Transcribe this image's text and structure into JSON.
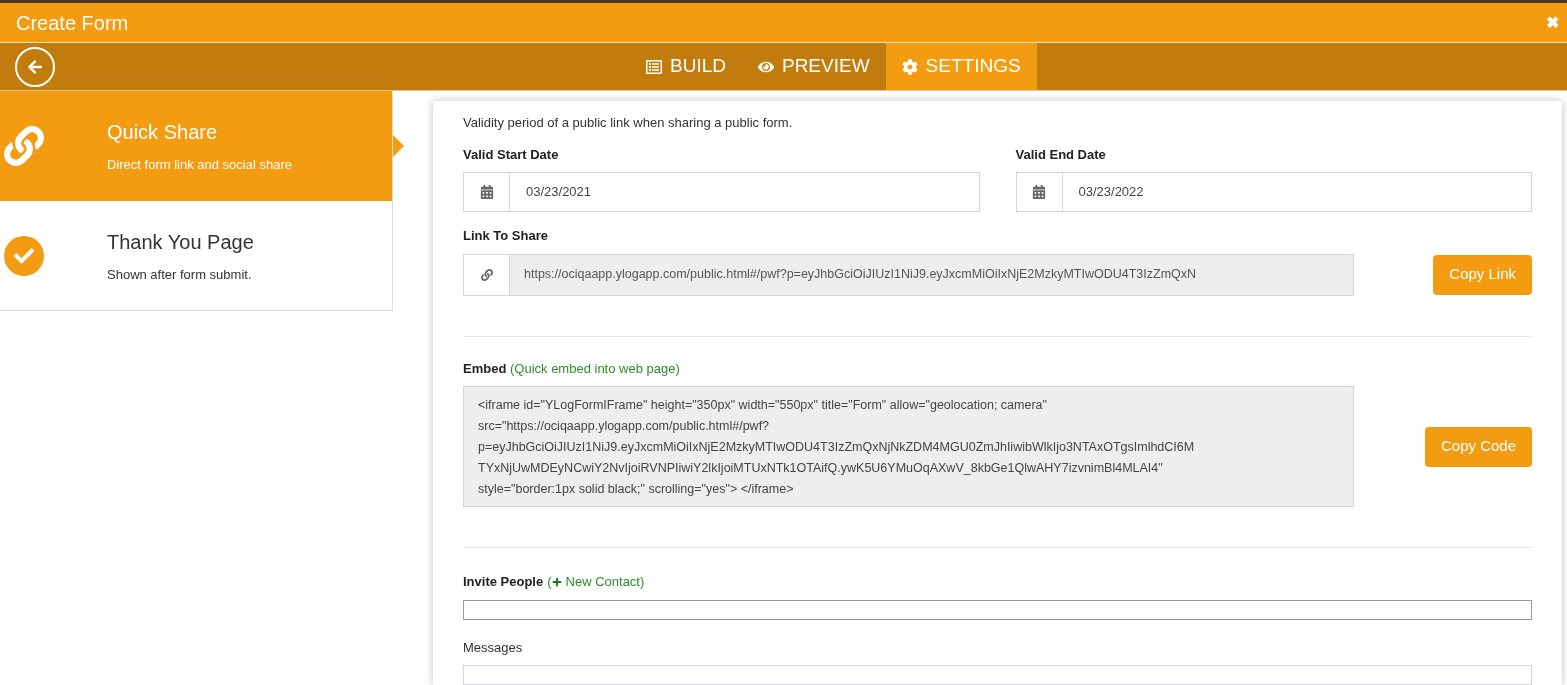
{
  "window": {
    "title": "Create Form",
    "close": "✖"
  },
  "nav_tabs": [
    {
      "label": "BUILD",
      "selected": false
    },
    {
      "label": "PREVIEW",
      "selected": false
    },
    {
      "label": "SETTINGS",
      "selected": true
    }
  ],
  "sidebar": {
    "items": [
      {
        "title": "Quick Share",
        "subtitle": "Direct form link and social share",
        "selected": true
      },
      {
        "title": "Thank You Page",
        "subtitle": "Shown after form submit.",
        "selected": false
      }
    ]
  },
  "settings": {
    "intro": "Validity period of a public link when sharing a public form.",
    "start_date": {
      "label": "Valid Start Date",
      "value": "03/23/2021"
    },
    "end_date": {
      "label": "Valid End Date",
      "value": "03/23/2022"
    },
    "link": {
      "label": "Link To Share",
      "value": "https://ociqaapp.ylogapp.com/public.html#/pwf?p=eyJhbGciOiJIUzI1NiJ9.eyJxcmMiOiIxNjE2MzkyMTIwODU4T3IzZmQxN",
      "button": "Copy Link"
    },
    "embed": {
      "label": "Embed",
      "hint": "(Quick embed into web page)",
      "code_lines": [
        "<iframe id=\"YLogFormIFrame\" height=\"350px\" width=\"550px\" title=\"Form\" allow=\"geolocation; camera\"",
        "src=\"https://ociqaapp.ylogapp.com/public.html#/pwf?",
        "p=eyJhbGciOiJIUzI1NiJ9.eyJxcmMiOiIxNjE2MzkyMTIwODU4T3IzZmQxNjNkZDM4MGU0ZmJhIiwibWlkIjo3NTAxOTgsImlhdCI6M",
        "TYxNjUwMDEyNCwiY2NvIjoiRVNPIiwiY2lkIjoiMTUxNTk1OTAifQ.ywK5U6YMuOqAXwV_8kbGe1QlwAHY7izvnimBl4MLAI4\"",
        "style=\"border:1px solid black;\" scrolling=\"yes\"> </iframe>"
      ],
      "button": "Copy Code"
    },
    "invite": {
      "label": "Invite People",
      "paren_open": "(",
      "link": "New Contact",
      "paren_close": ")"
    },
    "messages": {
      "label": "Messages"
    }
  }
}
